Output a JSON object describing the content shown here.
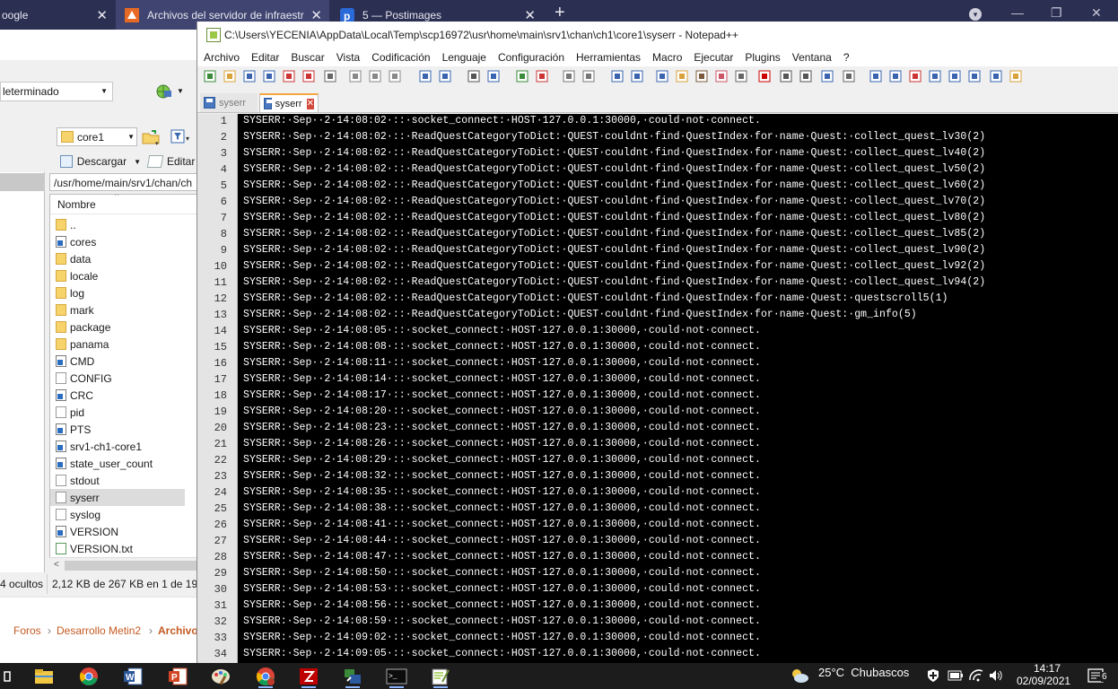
{
  "browser": {
    "tabs": [
      {
        "label": "oogle"
      },
      {
        "label": "Archivos del servidor de infraestr"
      },
      {
        "label": "5 — Postimages"
      }
    ],
    "new_tab_symbol": "+",
    "tab_dropdown_symbol": "▾",
    "close_symbol": "✕",
    "window_controls": {
      "minimize": "—",
      "restore": "❐",
      "close": "✕"
    }
  },
  "winscp": {
    "profile_combo": "leterminado",
    "dir_combo": "core1",
    "download_label": "Descargar",
    "edit_label": "Editar",
    "path": "/usr/home/main/srv1/chan/ch",
    "column_name": "Nombre",
    "files": [
      {
        "name": "..",
        "type": "up"
      },
      {
        "name": "cores",
        "type": "link"
      },
      {
        "name": "data",
        "type": "folder"
      },
      {
        "name": "locale",
        "type": "folder"
      },
      {
        "name": "log",
        "type": "folder"
      },
      {
        "name": "mark",
        "type": "folder"
      },
      {
        "name": "package",
        "type": "folder"
      },
      {
        "name": "panama",
        "type": "folder"
      },
      {
        "name": "CMD",
        "type": "link"
      },
      {
        "name": "CONFIG",
        "type": "file"
      },
      {
        "name": "CRC",
        "type": "link"
      },
      {
        "name": "pid",
        "type": "file"
      },
      {
        "name": "PTS",
        "type": "link"
      },
      {
        "name": "srv1-ch1-core1",
        "type": "link"
      },
      {
        "name": "state_user_count",
        "type": "link"
      },
      {
        "name": "stdout",
        "type": "file"
      },
      {
        "name": "syserr",
        "type": "file",
        "selected": true
      },
      {
        "name": "syslog",
        "type": "file"
      },
      {
        "name": "VERSION",
        "type": "link"
      },
      {
        "name": "VERSION.txt",
        "type": "txt"
      }
    ],
    "status_hidden": "4 ocultos",
    "status_size": "2,12 KB de 267 KB en 1 de 19"
  },
  "page_breadcrumb": {
    "items": [
      "Foros",
      "Desarrollo Metin2",
      "Archivo"
    ],
    "separator": "›"
  },
  "notepad": {
    "title": "C:\\Users\\YECENIA\\AppData\\Local\\Temp\\scp16972\\usr\\home\\main\\srv1\\chan\\ch1\\core1\\syserr - Notepad++",
    "menu": [
      "Archivo",
      "Editar",
      "Buscar",
      "Vista",
      "Codificación",
      "Lenguaje",
      "Configuración",
      "Herramientas",
      "Macro",
      "Ejecutar",
      "Plugins",
      "Ventana",
      "?"
    ],
    "doc_tabs": [
      {
        "label": "syserr",
        "active": false
      },
      {
        "label": "syserr",
        "active": true
      }
    ],
    "lines": [
      {
        "n": "1",
        "text": "SYSERR:·Sep··2·14:08:02·::·socket_connect:·HOST·127.0.0.1:30000,·could·not·connect."
      },
      {
        "n": "2",
        "text": "SYSERR:·Sep··2·14:08:02·::·ReadQuestCategoryToDict:·QUEST·couldnt·find·QuestIndex·for·name·Quest:·collect_quest_lv30(2)"
      },
      {
        "n": "3",
        "text": "SYSERR:·Sep··2·14:08:02·::·ReadQuestCategoryToDict:·QUEST·couldnt·find·QuestIndex·for·name·Quest:·collect_quest_lv40(2)"
      },
      {
        "n": "4",
        "text": "SYSERR:·Sep··2·14:08:02·::·ReadQuestCategoryToDict:·QUEST·couldnt·find·QuestIndex·for·name·Quest:·collect_quest_lv50(2)"
      },
      {
        "n": "5",
        "text": "SYSERR:·Sep··2·14:08:02·::·ReadQuestCategoryToDict:·QUEST·couldnt·find·QuestIndex·for·name·Quest:·collect_quest_lv60(2)"
      },
      {
        "n": "6",
        "text": "SYSERR:·Sep··2·14:08:02·::·ReadQuestCategoryToDict:·QUEST·couldnt·find·QuestIndex·for·name·Quest:·collect_quest_lv70(2)"
      },
      {
        "n": "7",
        "text": "SYSERR:·Sep··2·14:08:02·::·ReadQuestCategoryToDict:·QUEST·couldnt·find·QuestIndex·for·name·Quest:·collect_quest_lv80(2)"
      },
      {
        "n": "8",
        "text": "SYSERR:·Sep··2·14:08:02·::·ReadQuestCategoryToDict:·QUEST·couldnt·find·QuestIndex·for·name·Quest:·collect_quest_lv85(2)"
      },
      {
        "n": "9",
        "text": "SYSERR:·Sep··2·14:08:02·::·ReadQuestCategoryToDict:·QUEST·couldnt·find·QuestIndex·for·name·Quest:·collect_quest_lv90(2)"
      },
      {
        "n": "10",
        "text": "SYSERR:·Sep··2·14:08:02·::·ReadQuestCategoryToDict:·QUEST·couldnt·find·QuestIndex·for·name·Quest:·collect_quest_lv92(2)"
      },
      {
        "n": "11",
        "text": "SYSERR:·Sep··2·14:08:02·::·ReadQuestCategoryToDict:·QUEST·couldnt·find·QuestIndex·for·name·Quest:·collect_quest_lv94(2)"
      },
      {
        "n": "12",
        "text": "SYSERR:·Sep··2·14:08:02·::·ReadQuestCategoryToDict:·QUEST·couldnt·find·QuestIndex·for·name·Quest:·questscroll5(1)"
      },
      {
        "n": "13",
        "text": "SYSERR:·Sep··2·14:08:02·::·ReadQuestCategoryToDict:·QUEST·couldnt·find·QuestIndex·for·name·Quest:·gm_info(5)"
      },
      {
        "n": "14",
        "text": "SYSERR:·Sep··2·14:08:05·::·socket_connect:·HOST·127.0.0.1:30000,·could·not·connect."
      },
      {
        "n": "15",
        "text": "SYSERR:·Sep··2·14:08:08·::·socket_connect:·HOST·127.0.0.1:30000,·could·not·connect."
      },
      {
        "n": "16",
        "text": "SYSERR:·Sep··2·14:08:11·::·socket_connect:·HOST·127.0.0.1:30000,·could·not·connect."
      },
      {
        "n": "17",
        "text": "SYSERR:·Sep··2·14:08:14·::·socket_connect:·HOST·127.0.0.1:30000,·could·not·connect."
      },
      {
        "n": "18",
        "text": "SYSERR:·Sep··2·14:08:17·::·socket_connect:·HOST·127.0.0.1:30000,·could·not·connect."
      },
      {
        "n": "19",
        "text": "SYSERR:·Sep··2·14:08:20·::·socket_connect:·HOST·127.0.0.1:30000,·could·not·connect."
      },
      {
        "n": "20",
        "text": "SYSERR:·Sep··2·14:08:23·::·socket_connect:·HOST·127.0.0.1:30000,·could·not·connect."
      },
      {
        "n": "21",
        "text": "SYSERR:·Sep··2·14:08:26·::·socket_connect:·HOST·127.0.0.1:30000,·could·not·connect."
      },
      {
        "n": "22",
        "text": "SYSERR:·Sep··2·14:08:29·::·socket_connect:·HOST·127.0.0.1:30000,·could·not·connect."
      },
      {
        "n": "23",
        "text": "SYSERR:·Sep··2·14:08:32·::·socket_connect:·HOST·127.0.0.1:30000,·could·not·connect."
      },
      {
        "n": "24",
        "text": "SYSERR:·Sep··2·14:08:35·::·socket_connect:·HOST·127.0.0.1:30000,·could·not·connect."
      },
      {
        "n": "25",
        "text": "SYSERR:·Sep··2·14:08:38·::·socket_connect:·HOST·127.0.0.1:30000,·could·not·connect."
      },
      {
        "n": "26",
        "text": "SYSERR:·Sep··2·14:08:41·::·socket_connect:·HOST·127.0.0.1:30000,·could·not·connect."
      },
      {
        "n": "27",
        "text": "SYSERR:·Sep··2·14:08:44·::·socket_connect:·HOST·127.0.0.1:30000,·could·not·connect."
      },
      {
        "n": "28",
        "text": "SYSERR:·Sep··2·14:08:47·::·socket_connect:·HOST·127.0.0.1:30000,·could·not·connect."
      },
      {
        "n": "29",
        "text": "SYSERR:·Sep··2·14:08:50·::·socket_connect:·HOST·127.0.0.1:30000,·could·not·connect."
      },
      {
        "n": "30",
        "text": "SYSERR:·Sep··2·14:08:53·::·socket_connect:·HOST·127.0.0.1:30000,·could·not·connect."
      },
      {
        "n": "31",
        "text": "SYSERR:·Sep··2·14:08:56·::·socket_connect:·HOST·127.0.0.1:30000,·could·not·connect."
      },
      {
        "n": "32",
        "text": "SYSERR:·Sep··2·14:08:59·::·socket_connect:·HOST·127.0.0.1:30000,·could·not·connect."
      },
      {
        "n": "33",
        "text": "SYSERR:·Sep··2·14:09:02·::·socket_connect:·HOST·127.0.0.1:30000,·could·not·connect."
      },
      {
        "n": "34",
        "text": "SYSERR:·Sep··2·14:09:05·::·socket_connect:·HOST·127.0.0.1:30000,·could·not·connect."
      }
    ]
  },
  "taskbar": {
    "weather": "25°C  Chubascos",
    "time": "14:17",
    "date": "02/09/2021",
    "notifications": "6",
    "apps": [
      "file-explorer-icon",
      "chrome-icon",
      "word-icon",
      "powerpoint-icon",
      "paint-icon",
      "chrome-profile-icon",
      "filezilla-icon",
      "winscp-icon",
      "terminal-icon",
      "notepadpp-icon"
    ],
    "colors": {
      "background": "#1c1c1c",
      "running_indicator": "#8bb4ff"
    }
  },
  "colors": {
    "browser_tabbar": "#2b2f52",
    "editor_bg": "#000000",
    "editor_text": "#ffffff",
    "active_tab_accent": "#f6a640",
    "breadcrumb_link": "#c45a22"
  }
}
